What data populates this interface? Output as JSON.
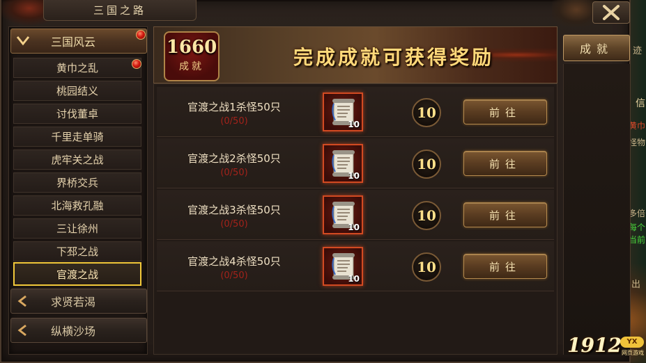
{
  "window": {
    "title": "三国之路"
  },
  "sidebar": {
    "expanded_category": {
      "label": "三国风云",
      "has_alert": true
    },
    "sub_items": [
      {
        "label": "黄巾之乱",
        "has_alert": true,
        "active": false
      },
      {
        "label": "桃园结义",
        "has_alert": false,
        "active": false
      },
      {
        "label": "讨伐董卓",
        "has_alert": false,
        "active": false
      },
      {
        "label": "千里走单骑",
        "has_alert": false,
        "active": false
      },
      {
        "label": "虎牢关之战",
        "has_alert": false,
        "active": false
      },
      {
        "label": "界桥交兵",
        "has_alert": false,
        "active": false
      },
      {
        "label": "北海救孔融",
        "has_alert": false,
        "active": false
      },
      {
        "label": "三让徐州",
        "has_alert": false,
        "active": false
      },
      {
        "label": "下邳之战",
        "has_alert": false,
        "active": false
      },
      {
        "label": "官渡之战",
        "has_alert": false,
        "active": true
      }
    ],
    "collapsed_categories": [
      {
        "label": "求贤若渴"
      },
      {
        "label": "纵横沙场"
      }
    ]
  },
  "banner": {
    "score": "1660",
    "score_label": "成就",
    "headline": "完成成就可获得奖励"
  },
  "tasks": [
    {
      "name": "官渡之战1杀怪50只",
      "progress": "(0/50)",
      "reward_count": "10",
      "points": "10",
      "button": "前往"
    },
    {
      "name": "官渡之战2杀怪50只",
      "progress": "(0/50)",
      "reward_count": "10",
      "points": "10",
      "button": "前往"
    },
    {
      "name": "官渡之战3杀怪50只",
      "progress": "(0/50)",
      "reward_count": "10",
      "points": "10",
      "button": "前往"
    },
    {
      "name": "官渡之战4杀怪50只",
      "progress": "(0/50)",
      "reward_count": "10",
      "points": "10",
      "button": "前往"
    }
  ],
  "right_tab": {
    "label": "成就"
  },
  "background_fragments": {
    "top": "迹",
    "a": "信",
    "b": "黄巾",
    "c": "怪物",
    "d": "多倍",
    "e": "每个",
    "f": "当前",
    "g": "出"
  },
  "logo": {
    "number": "1912",
    "badge": "YX",
    "sub": "网页游戏"
  },
  "colors": {
    "accent_gold": "#f2c93a",
    "progress_red": "#a3221a",
    "alert_red": "#d21a10"
  }
}
